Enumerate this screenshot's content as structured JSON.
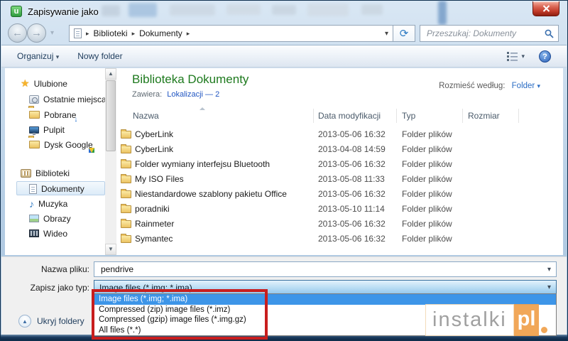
{
  "window": {
    "title": "Zapisywanie jako"
  },
  "nav": {
    "breadcrumb": [
      "Biblioteki",
      "Dokumenty"
    ],
    "search_placeholder": "Przeszukaj: Dokumenty"
  },
  "toolbar": {
    "organize": "Organizuj",
    "new_folder": "Nowy folder"
  },
  "sidebar": {
    "groups": [
      {
        "label": "Ulubione",
        "items": [
          {
            "label": "Ostatnie miejsca"
          },
          {
            "label": "Pobrane"
          },
          {
            "label": "Pulpit"
          },
          {
            "label": "Dysk Google"
          }
        ]
      },
      {
        "label": "Biblioteki",
        "items": [
          {
            "label": "Dokumenty"
          },
          {
            "label": "Muzyka"
          },
          {
            "label": "Obrazy"
          },
          {
            "label": "Wideo"
          }
        ]
      }
    ]
  },
  "main": {
    "library_title": "Biblioteka Dokumenty",
    "contains_label": "Zawiera:",
    "contains_value": "Lokalizacji — 2",
    "arrange_label": "Rozmieść według:",
    "arrange_value": "Folder",
    "columns": [
      "Nazwa",
      "Data modyfikacji",
      "Typ",
      "Rozmiar"
    ],
    "rows": [
      {
        "name": "CyberLink",
        "modified": "2013-05-06 16:32",
        "type": "Folder plików"
      },
      {
        "name": "CyberLink",
        "modified": "2013-04-08 14:59",
        "type": "Folder plików"
      },
      {
        "name": "Folder wymiany interfejsu Bluetooth",
        "modified": "2013-05-06 16:32",
        "type": "Folder plików"
      },
      {
        "name": "My ISO Files",
        "modified": "2013-05-08 11:33",
        "type": "Folder plików"
      },
      {
        "name": "Niestandardowe szablony pakietu Office",
        "modified": "2013-05-06 16:32",
        "type": "Folder plików"
      },
      {
        "name": "poradniki",
        "modified": "2013-05-10 11:14",
        "type": "Folder plików"
      },
      {
        "name": "Rainmeter",
        "modified": "2013-05-06 16:32",
        "type": "Folder plików"
      },
      {
        "name": "Symantec",
        "modified": "2013-05-06 16:32",
        "type": "Folder plików"
      }
    ]
  },
  "save_form": {
    "filename_label": "Nazwa pliku:",
    "filename_value": "pendrive",
    "filetype_label": "Zapisz jako typ:",
    "filetype_value": "Image files (*.img; *.ima)",
    "filetype_options": [
      "Image files (*.img; *.ima)",
      "Compressed (zip) image files (*.imz)",
      "Compressed (gzip) image files (*.img.gz)",
      "All files (*.*)"
    ]
  },
  "footer": {
    "hide_folders_label": "Ukryj foldery"
  },
  "watermark": {
    "name": "instalki",
    "tld": "pl"
  },
  "glyphs": {
    "app_icon_letter": "u",
    "back": "←",
    "forward": "→",
    "chevron_down": "▾",
    "crumb_arrow": "▸",
    "refresh": "⟳",
    "help": "?",
    "scroll_up": "▲",
    "scroll_down": "▼",
    "hide_arrow": "▲",
    "star": "★",
    "music_note": "♪"
  },
  "colors": {
    "selection_blue": "#3d95e8",
    "annotation_red": "#c81e1e",
    "library_title_green": "#1e7a1e",
    "link_blue": "#2156c2"
  }
}
